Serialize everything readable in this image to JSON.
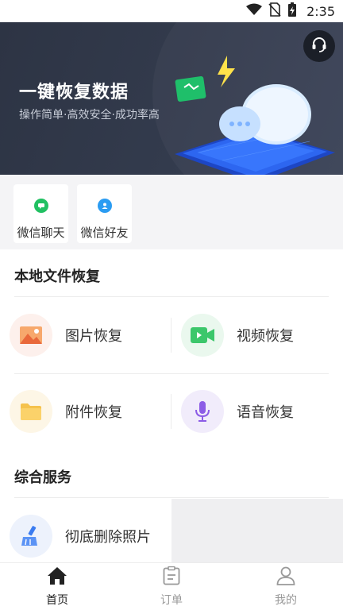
{
  "status_bar": {
    "time": "2:35",
    "icons": [
      "wifi-icon",
      "no-sim-icon",
      "battery-charging-icon"
    ]
  },
  "banner": {
    "title": "一键恢复数据",
    "subtitle": "操作简单·高效安全·成功率高",
    "support_icon": "headset-icon"
  },
  "quick_tools": [
    {
      "label": "微信聊天",
      "icon": "wechat-chat-icon",
      "color": "#21c062"
    },
    {
      "label": "微信好友",
      "icon": "wechat-friend-icon",
      "color": "#2b9cf2"
    }
  ],
  "local_recovery": {
    "title": "本地文件恢复",
    "items": [
      {
        "label": "图片恢复",
        "icon": "image-icon",
        "color": "#f4845f",
        "bg": "#fdf0ec"
      },
      {
        "label": "视频恢复",
        "icon": "video-icon",
        "color": "#3cc76b",
        "bg": "#eaf8ee"
      },
      {
        "label": "附件恢复",
        "icon": "folder-icon",
        "color": "#f5c24c",
        "bg": "#fdf6e6"
      },
      {
        "label": "语音恢复",
        "icon": "microphone-icon",
        "color": "#8c5ce6",
        "bg": "#f1ecfb"
      }
    ]
  },
  "services": {
    "title": "综合服务",
    "items": [
      {
        "label": "彻底删除照片",
        "icon": "broom-icon",
        "color": "#3b7cf0",
        "bg": "#edf2fc"
      }
    ]
  },
  "bottom_nav": [
    {
      "label": "首页",
      "icon": "home-icon",
      "active": true
    },
    {
      "label": "订单",
      "icon": "order-icon",
      "active": false
    },
    {
      "label": "我的",
      "icon": "profile-icon",
      "active": false
    }
  ],
  "colors": {
    "active": "#222222",
    "inactive": "#999999",
    "banner_bg": "#2f3647"
  }
}
